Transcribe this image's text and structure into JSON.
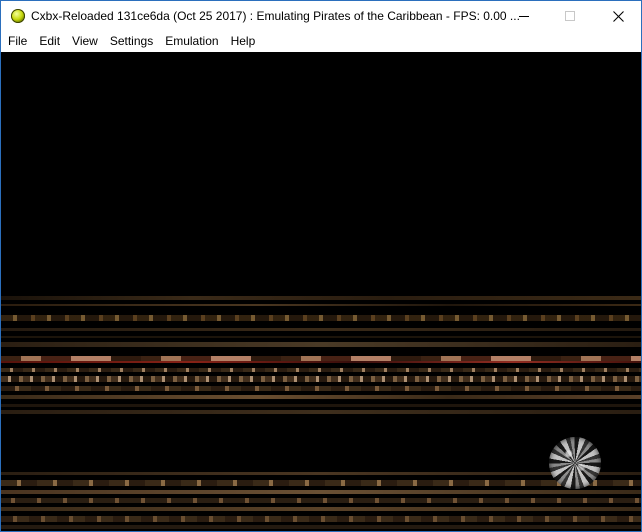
{
  "window": {
    "title": "Cxbx-Reloaded 131ce6da (Oct 25 2017) : Emulating Pirates of the Caribbean - FPS: 0.00  ...",
    "app_icon": "cxbx-app-icon",
    "controls": {
      "minimize": "minimize-icon",
      "maximize": "maximize-icon",
      "close": "close-icon"
    }
  },
  "menu": {
    "items": [
      "File",
      "Edit",
      "View",
      "Settings",
      "Emulation",
      "Help"
    ]
  },
  "viewport": {
    "background": "#000000",
    "overlay_icon": "spinning-disc-icon"
  }
}
